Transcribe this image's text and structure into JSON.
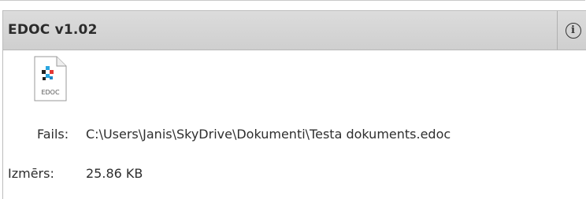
{
  "panel": {
    "title": "EDOC v1.02",
    "info_icon_glyph": "i",
    "file_icon": {
      "name": "edoc-file-icon",
      "label": "EDOC"
    },
    "file_label": "Fails:",
    "file_path": "C:\\Users\\Janis\\SkyDrive\\Dokumenti\\Testa dokuments.edoc",
    "size_label": "Izmērs:",
    "size_value": "25.86 KB"
  },
  "colors": {
    "header_bg": "#d6d6d6",
    "text": "#2e2e2e",
    "border": "#bdbdbd"
  }
}
